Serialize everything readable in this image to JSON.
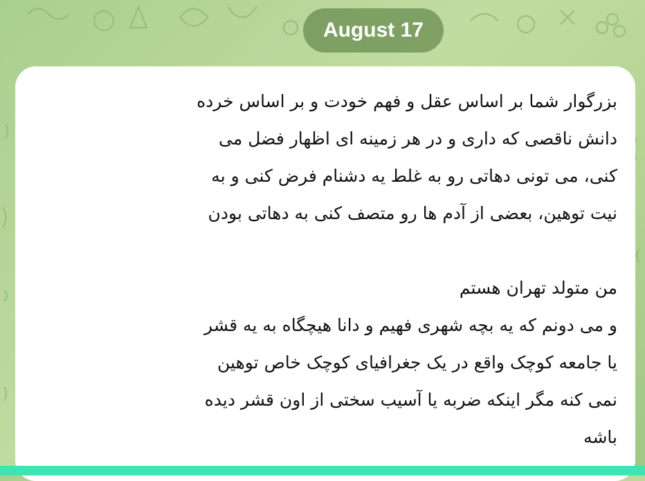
{
  "date_badge": "August 17",
  "message": {
    "paragraph_1": [
      "بزرگوار شما بر اساس عقل و فهم خودت و بر اساس خرده",
      "دانش ناقصی که داری و در هر زمینه ای اظهار فضل می",
      "کنی، می تونی دهاتی رو به غلط یه دشنام فرض کنی و به",
      "نیت توهین، بعضی از آدم ها رو متصف کنی به دهاتی بودن"
    ],
    "paragraph_2": [
      "من متولد تهران هستم",
      "و می دونم که یه بچه شهری فهیم و دانا هیچگاه به یه قشر",
      "یا جامعه کوچک واقع در یک جغرافیای کوچک خاص توهین",
      "نمی کنه مگر اینکه ضربه یا آسیب سختی از اون قشر دیده",
      "باشه"
    ]
  },
  "colors": {
    "wallpaper": "#b7d596",
    "date_pill": "#66894e",
    "bubble": "#ffffff",
    "bottom_strip": "#3fe3b4"
  }
}
